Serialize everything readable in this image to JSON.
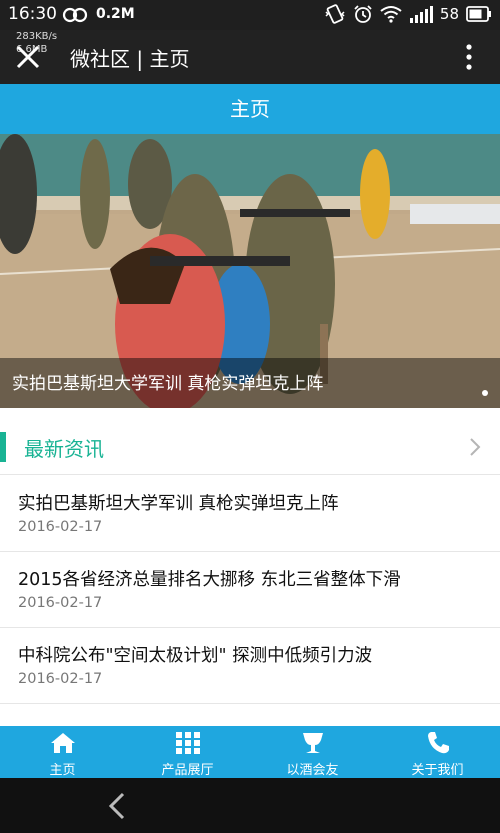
{
  "status_bar": {
    "time": "16:30",
    "speed": "0.2M",
    "battery": "58"
  },
  "app_bar": {
    "overlay_line1": "283KB/s",
    "overlay_line2": "6.6MB",
    "title": "微社区 | 主页"
  },
  "page_header": {
    "title": "主页"
  },
  "banner": {
    "caption": "实拍巴基斯坦大学军训 真枪实弹坦克上阵"
  },
  "section": {
    "title": "最新资讯"
  },
  "news": [
    {
      "title": "实拍巴基斯坦大学军训 真枪实弹坦克上阵",
      "date": "2016-02-17"
    },
    {
      "title": "2015各省经济总量排名大挪移 东北三省整体下滑",
      "date": "2016-02-17"
    },
    {
      "title": "中科院公布\"空间太极计划\" 探测中低频引力波",
      "date": "2016-02-17"
    }
  ],
  "bottom_nav": [
    {
      "label": "主页",
      "icon": "home-icon"
    },
    {
      "label": "产品展厅",
      "icon": "grid-icon"
    },
    {
      "label": "以酒会友",
      "icon": "glass-icon"
    },
    {
      "label": "关于我们",
      "icon": "phone-icon"
    }
  ],
  "colors": {
    "accent_blue": "#1fa7df",
    "accent_green": "#19b394",
    "app_bar": "#222222"
  }
}
